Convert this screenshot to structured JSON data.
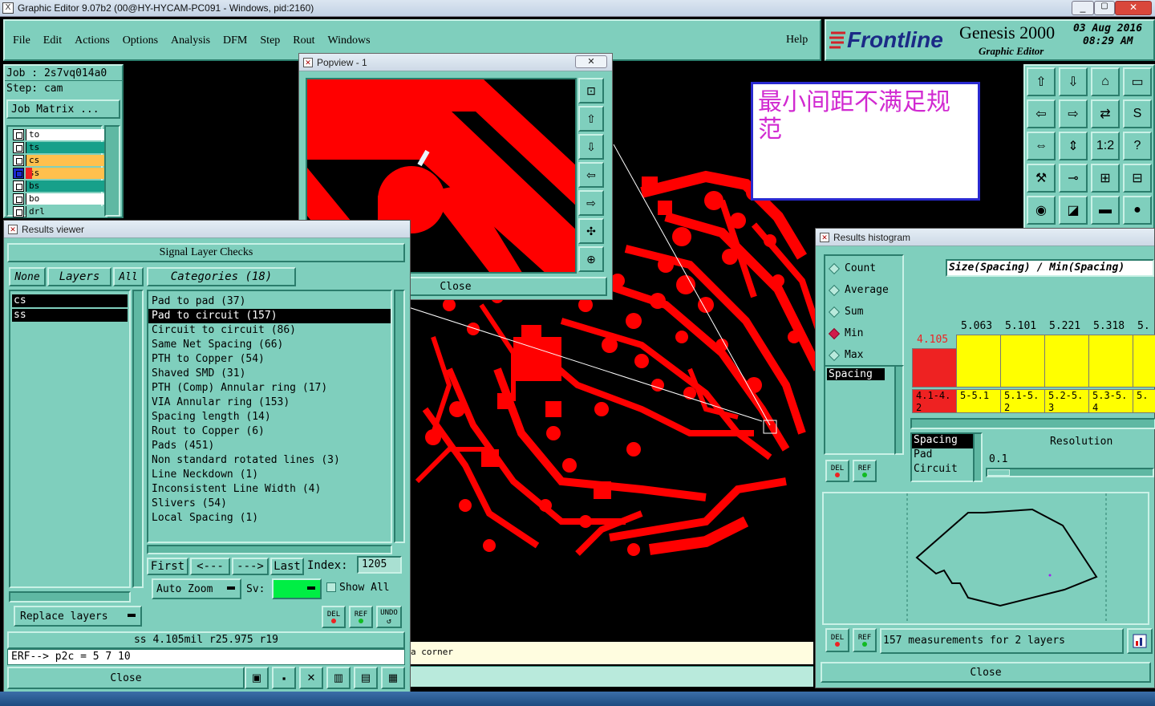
{
  "window": {
    "title": "Graphic Editor 9.07b2 (00@HY-HYCAM-PC091 - Windows, pid:2160)"
  },
  "menu": {
    "items": [
      "File",
      "Edit",
      "Actions",
      "Options",
      "Analysis",
      "DFM",
      "Step",
      "Rout",
      "Windows"
    ],
    "help": "Help"
  },
  "brand": {
    "logo": "Frontline",
    "product": "Genesis 2000",
    "subtitle": "Graphic Editor",
    "date": "03 Aug 2016",
    "time": "08:29 AM"
  },
  "job": {
    "job_label": "Job : 2s7vq014a0",
    "step_label": "Step: cam",
    "matrix_button": "Job Matrix ..."
  },
  "layers": [
    {
      "name": "to",
      "color": "#ffffff"
    },
    {
      "name": "ts",
      "color": "#17a08a"
    },
    {
      "name": "cs",
      "color": "#ffc04d"
    },
    {
      "name": "ss",
      "color": "#ffc04d"
    },
    {
      "name": "bs",
      "color": "#17a08a"
    },
    {
      "name": "bo",
      "color": "#ffffff"
    },
    {
      "name": "drl",
      "color": "#7fcfbd"
    }
  ],
  "annotation": {
    "text": "最小间距不满足规范"
  },
  "popview": {
    "title": "Popview - 1",
    "close": "Close"
  },
  "results_viewer": {
    "title": "Results viewer",
    "heading": "Signal Layer Checks",
    "tabs": {
      "none": "None",
      "layers": "Layers",
      "all": "All",
      "categories": "Categories (18)"
    },
    "layer_list": [
      "cs",
      "ss"
    ],
    "categories": [
      "Pad to pad (37)",
      "Pad to circuit (157)",
      "Circuit to circuit (86)",
      "Same Net Spacing (66)",
      "PTH to Copper (54)",
      "Shaved SMD (31)",
      "PTH (Comp) Annular ring (17)",
      "VIA Annular ring (153)",
      "Spacing length (14)",
      "Rout to Copper (6)",
      "Pads (451)",
      "Non standard rotated lines (3)",
      "Line Neckdown (1)",
      "Inconsistent Line Width (4)",
      "Slivers (54)",
      "Local Spacing (1)"
    ],
    "selected_category": 1,
    "nav": {
      "first": "First",
      "prev": "<---",
      "next": "--->",
      "last": "Last",
      "index_label": "Index:",
      "index_value": "1205"
    },
    "auto_zoom": "Auto Zoom",
    "sv_label": "Sv:",
    "show_all": "Show All",
    "replace_layers": "Replace layers",
    "del": "DEL",
    "ref": "REF",
    "undo": "UNDO",
    "status": "ss 4.105mil   r25.975  r19",
    "erf": "ERF--> p2c = 5 7 10",
    "close": "Close"
  },
  "canvas_message": "a corner",
  "histogram": {
    "title": "Results histogram",
    "stats": [
      "Count",
      "Average",
      "Sum",
      "Min",
      "Max"
    ],
    "selected_stat": "Min",
    "axis_title": "Size(Spacing) / Min(Spacing)",
    "list_selected": "Spacing",
    "bars": [
      {
        "value": "4.105",
        "range": "4.1-4.2",
        "color": "#ee2222",
        "height": 0.74
      },
      {
        "value": "5.063",
        "range": "5-5.1",
        "color": "#ffff00",
        "height": 1.0
      },
      {
        "value": "5.101",
        "range": "5.1-5.2",
        "color": "#ffff00",
        "height": 1.0
      },
      {
        "value": "5.221",
        "range": "5.2-5.3",
        "color": "#ffff00",
        "height": 1.0
      },
      {
        "value": "5.318",
        "range": "5.3-5.4",
        "color": "#ffff00",
        "height": 1.0
      },
      {
        "value": "5.",
        "range": "5.",
        "color": "#ffff00",
        "height": 1.0
      }
    ],
    "attributes": [
      "Spacing",
      "Pad",
      "Circuit"
    ],
    "resolution_label": "Resolution",
    "resolution_value": "0.1",
    "measurements": "157 measurements for 2 layers",
    "del": "DEL",
    "ref": "REF",
    "close": "Close"
  }
}
